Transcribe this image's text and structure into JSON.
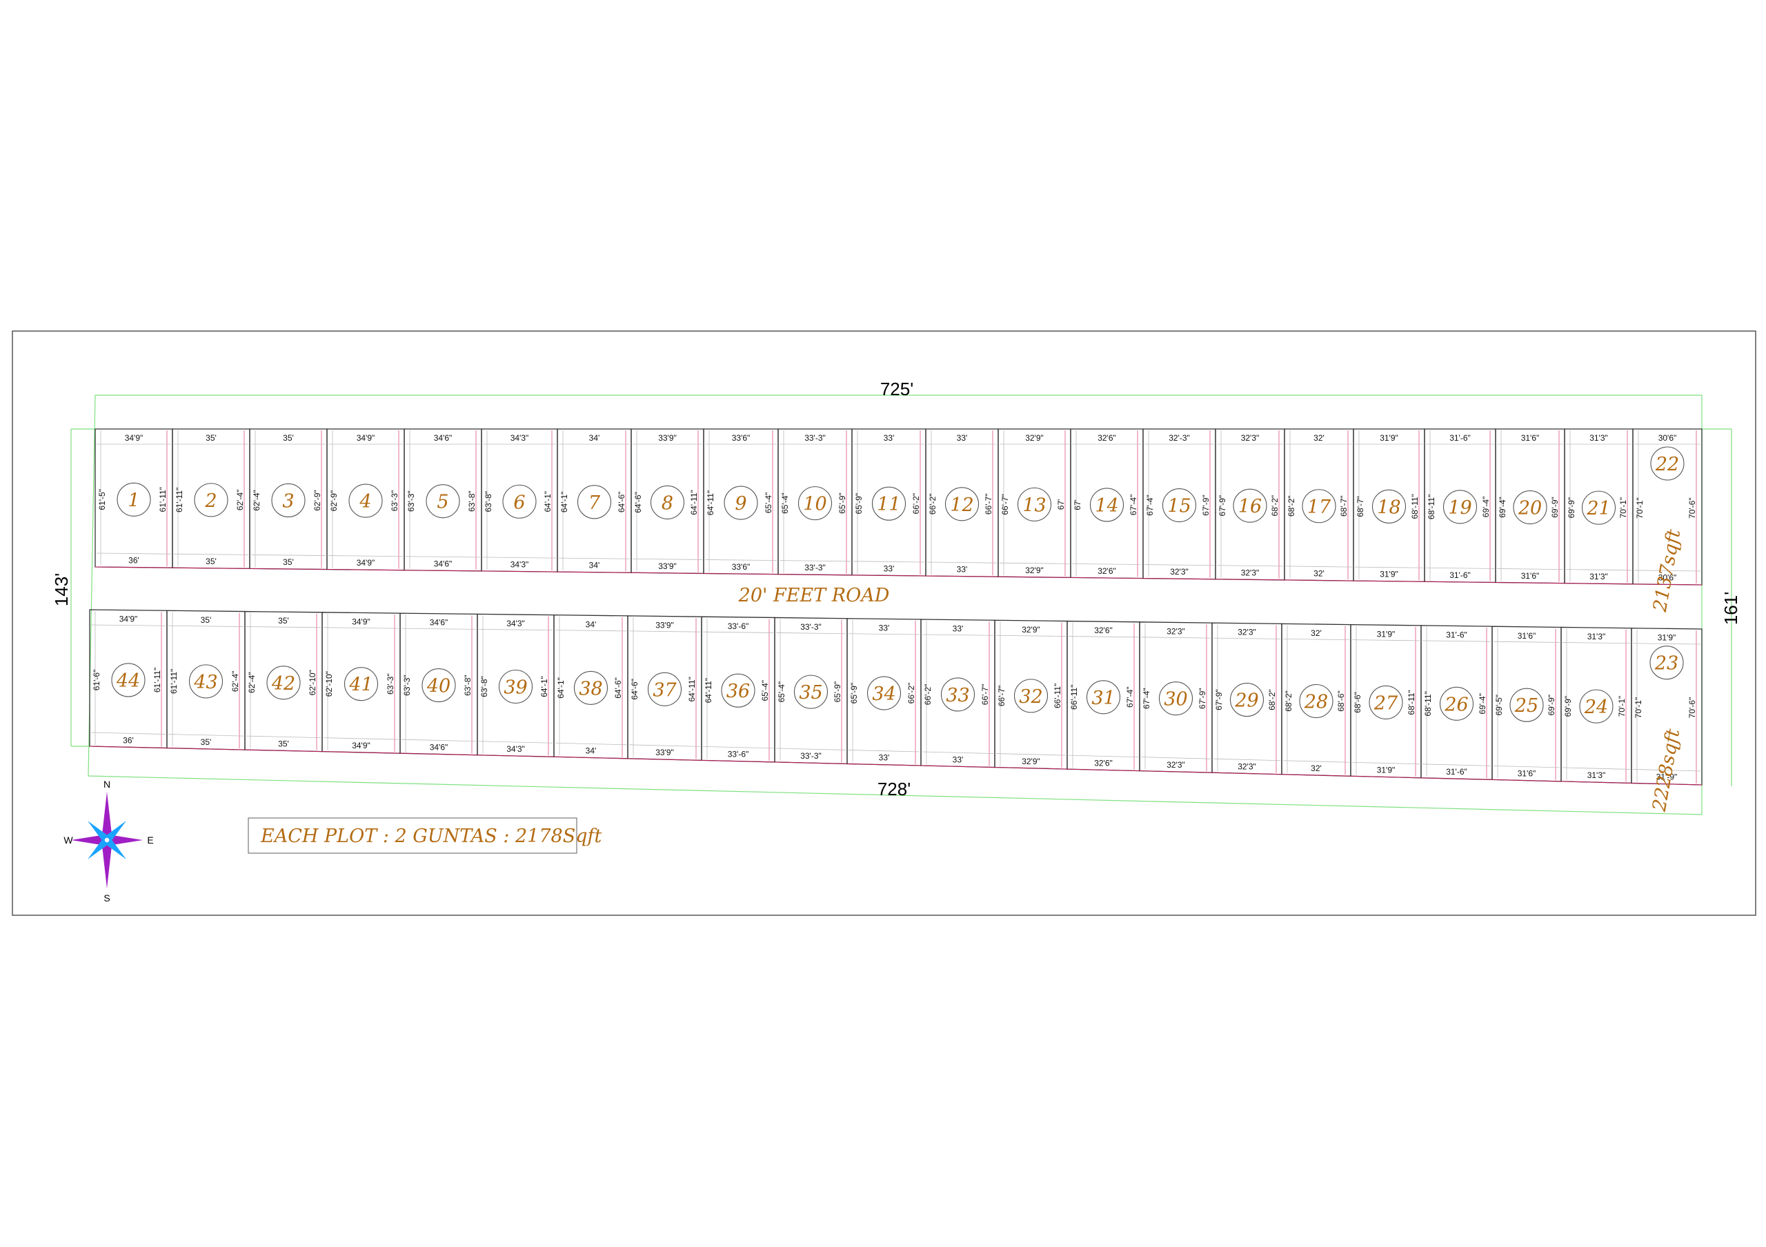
{
  "totals": {
    "top": "725'",
    "bottom": "728'",
    "left": "143'",
    "right": "161'"
  },
  "road_label": "20' FEET ROAD",
  "note": "EACH PLOT  : 2 GUNTAS : 2178Sqft",
  "compass": {
    "n": "N",
    "s": "S",
    "e": "E",
    "w": "W"
  },
  "top_plots": [
    {
      "n": "1",
      "top": "34'9\"",
      "bot": "36'",
      "left": "61'-5\"",
      "right": "61'-11\""
    },
    {
      "n": "2",
      "top": "35'",
      "bot": "35'",
      "left": "61'-11\"",
      "right": "62'-4\""
    },
    {
      "n": "3",
      "top": "35'",
      "bot": "35'",
      "left": "62'-4\"",
      "right": "62'-9\""
    },
    {
      "n": "4",
      "top": "34'9\"",
      "bot": "34'9\"",
      "left": "62'-9\"",
      "right": "63'-3\""
    },
    {
      "n": "5",
      "top": "34'6\"",
      "bot": "34'6\"",
      "left": "63'-3\"",
      "right": "63'-8\""
    },
    {
      "n": "6",
      "top": "34'3\"",
      "bot": "34'3\"",
      "left": "63'-8\"",
      "right": "64'-1\""
    },
    {
      "n": "7",
      "top": "34'",
      "bot": "34'",
      "left": "64'-1\"",
      "right": "64'-6\""
    },
    {
      "n": "8",
      "top": "33'9\"",
      "bot": "33'9\"",
      "left": "64'-6\"",
      "right": "64'-11\""
    },
    {
      "n": "9",
      "top": "33'6\"",
      "bot": "33'6\"",
      "left": "64'-11\"",
      "right": "65'-4\""
    },
    {
      "n": "10",
      "top": "33'-3\"",
      "bot": "33'-3\"",
      "left": "65'-4\"",
      "right": "65'-9\""
    },
    {
      "n": "11",
      "top": "33'",
      "bot": "33'",
      "left": "65'-9\"",
      "right": "66'-2\""
    },
    {
      "n": "12",
      "top": "33'",
      "bot": "33'",
      "left": "66'-2\"",
      "right": "66'-7\""
    },
    {
      "n": "13",
      "top": "32'9\"",
      "bot": "32'9\"",
      "left": "66'-7\"",
      "right": "67'"
    },
    {
      "n": "14",
      "top": "32'6\"",
      "bot": "32'6\"",
      "left": "67'",
      "right": "67'-4\""
    },
    {
      "n": "15",
      "top": "32'-3\"",
      "bot": "32'3\"",
      "left": "67'-4\"",
      "right": "67'-9\""
    },
    {
      "n": "16",
      "top": "32'3\"",
      "bot": "32'3\"",
      "left": "67'-9\"",
      "right": "68'-2\""
    },
    {
      "n": "17",
      "top": "32'",
      "bot": "32'",
      "left": "68'-2\"",
      "right": "68'-7\""
    },
    {
      "n": "18",
      "top": "31'9\"",
      "bot": "31'9\"",
      "left": "68'-7\"",
      "right": "68'-11\""
    },
    {
      "n": "19",
      "top": "31'-6\"",
      "bot": "31'-6\"",
      "left": "68'-11\"",
      "right": "69'-4\""
    },
    {
      "n": "20",
      "top": "31'6\"",
      "bot": "31'6\"",
      "left": "69'-4\"",
      "right": "69'-9\""
    },
    {
      "n": "21",
      "top": "31'3\"",
      "bot": "31'3\"",
      "left": "69'-9\"",
      "right": "70'-1\""
    },
    {
      "n": "22",
      "top": "30'6\"",
      "bot": "30'6\"",
      "left": "70'-1\"",
      "right": "70'-6\"",
      "area": "2137sqft"
    }
  ],
  "bottom_plots": [
    {
      "n": "44",
      "top": "34'9\"",
      "bot": "36'",
      "left": "61'-6\"",
      "right": "61'-11\""
    },
    {
      "n": "43",
      "top": "35'",
      "bot": "35'",
      "left": "61'-11\"",
      "right": "62'-4\""
    },
    {
      "n": "42",
      "top": "35'",
      "bot": "35'",
      "left": "62'-4\"",
      "right": "62'-10\""
    },
    {
      "n": "41",
      "top": "34'9\"",
      "bot": "34'9\"",
      "left": "62'-10\"",
      "right": "63'-3\""
    },
    {
      "n": "40",
      "top": "34'6\"",
      "bot": "34'6\"",
      "left": "63'-3\"",
      "right": "63'-8\""
    },
    {
      "n": "39",
      "top": "34'3\"",
      "bot": "34'3\"",
      "left": "63'-8\"",
      "right": "64'-1\""
    },
    {
      "n": "38",
      "top": "34'",
      "bot": "34'",
      "left": "64'-1\"",
      "right": "64'-6\""
    },
    {
      "n": "37",
      "top": "33'9\"",
      "bot": "33'9\"",
      "left": "64'-6\"",
      "right": "64'-11\""
    },
    {
      "n": "36",
      "top": "33'-6\"",
      "bot": "33'-6\"",
      "left": "64'-11\"",
      "right": "65'-4\""
    },
    {
      "n": "35",
      "top": "33'-3\"",
      "bot": "33'-3\"",
      "left": "65'-4\"",
      "right": "65'-9\""
    },
    {
      "n": "34",
      "top": "33'",
      "bot": "33'",
      "left": "65'-9\"",
      "right": "66'-2\""
    },
    {
      "n": "33",
      "top": "33'",
      "bot": "33'",
      "left": "66'-2\"",
      "right": "66'-7\""
    },
    {
      "n": "32",
      "top": "32'9\"",
      "bot": "32'9\"",
      "left": "66'-7\"",
      "right": "66'-11\""
    },
    {
      "n": "31",
      "top": "32'6\"",
      "bot": "32'6\"",
      "left": "66'-11\"",
      "right": "67'-4\""
    },
    {
      "n": "30",
      "top": "32'3\"",
      "bot": "32'3\"",
      "left": "67'-4\"",
      "right": "67'-9\""
    },
    {
      "n": "29",
      "top": "32'3\"",
      "bot": "32'3\"",
      "left": "67'-9\"",
      "right": "68'-2\""
    },
    {
      "n": "28",
      "top": "32'",
      "bot": "32'",
      "left": "68'-2\"",
      "right": "68'-6\""
    },
    {
      "n": "27",
      "top": "31'9\"",
      "bot": "31'9\"",
      "left": "68'-6\"",
      "right": "68'-11\""
    },
    {
      "n": "26",
      "top": "31'-6\"",
      "bot": "31'-6\"",
      "left": "68'-11\"",
      "right": "69'-4\""
    },
    {
      "n": "25",
      "top": "31'6\"",
      "bot": "31'6\"",
      "left": "69'-5\"",
      "right": "69'-9\""
    },
    {
      "n": "24",
      "top": "31'3\"",
      "bot": "31'3\"",
      "left": "69'-9\"",
      "right": "70'-1\""
    },
    {
      "n": "23",
      "top": "31'9\"",
      "bot": "31'-9\"",
      "left": "70'-1\"",
      "right": "70'-6\"",
      "area": "2228sqft"
    }
  ]
}
